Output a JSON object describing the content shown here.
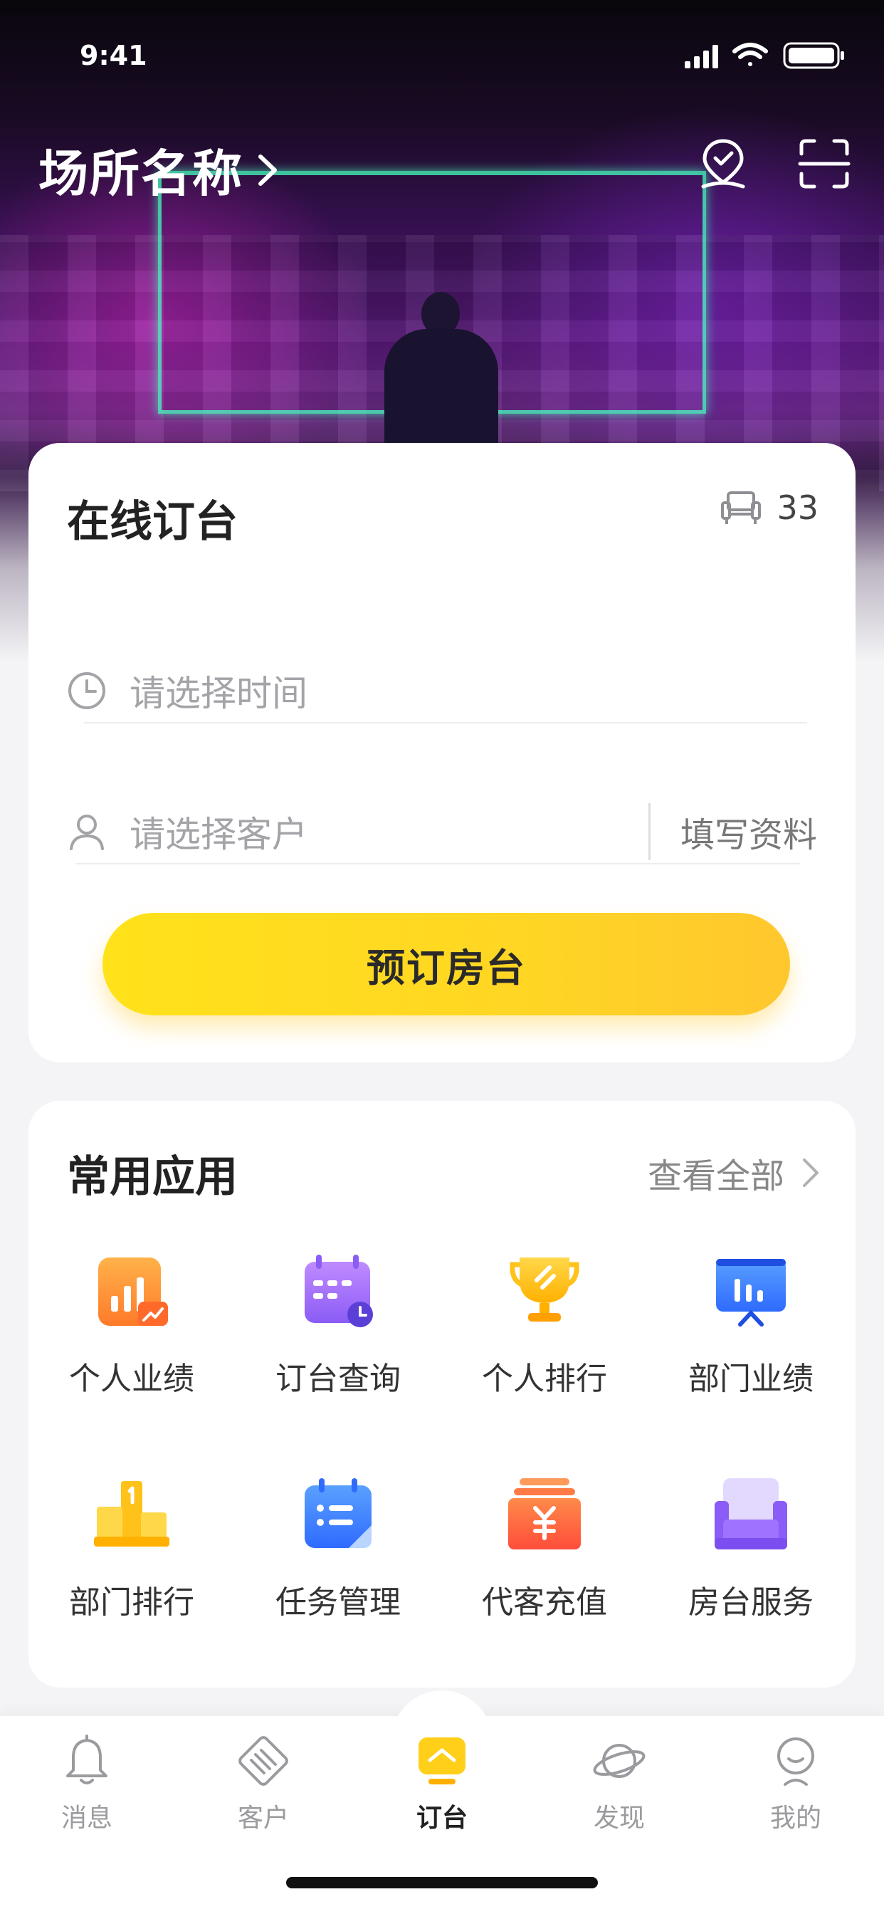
{
  "status_bar": {
    "time": "9:41"
  },
  "header": {
    "venue_name": "场所名称"
  },
  "booking": {
    "title": "在线订台",
    "seat_count": "33",
    "time_placeholder": "请选择时间",
    "customer_placeholder": "请选择客户",
    "fill_info_label": "填写资料",
    "book_button_label": "预订房台"
  },
  "apps": {
    "title": "常用应用",
    "view_all_label": "查看全部",
    "items": [
      {
        "label": "个人业绩",
        "icon": "personal-performance-icon"
      },
      {
        "label": "订台查询",
        "icon": "booking-query-icon"
      },
      {
        "label": "个人排行",
        "icon": "trophy-icon"
      },
      {
        "label": "部门业绩",
        "icon": "department-performance-icon"
      },
      {
        "label": "部门排行",
        "icon": "podium-icon"
      },
      {
        "label": "任务管理",
        "icon": "task-list-icon"
      },
      {
        "label": "代客充值",
        "icon": "recharge-icon"
      },
      {
        "label": "房台服务",
        "icon": "room-service-icon"
      }
    ]
  },
  "tab_bar": {
    "items": [
      {
        "label": "消息",
        "icon": "bell-icon"
      },
      {
        "label": "客户",
        "icon": "handshake-icon"
      },
      {
        "label": "订台",
        "icon": "booking-icon",
        "active": true
      },
      {
        "label": "发现",
        "icon": "planet-icon"
      },
      {
        "label": "我的",
        "icon": "profile-icon"
      }
    ]
  },
  "colors": {
    "accent": "#ffd21e",
    "text": "#222222",
    "muted": "#a3a3a8"
  }
}
